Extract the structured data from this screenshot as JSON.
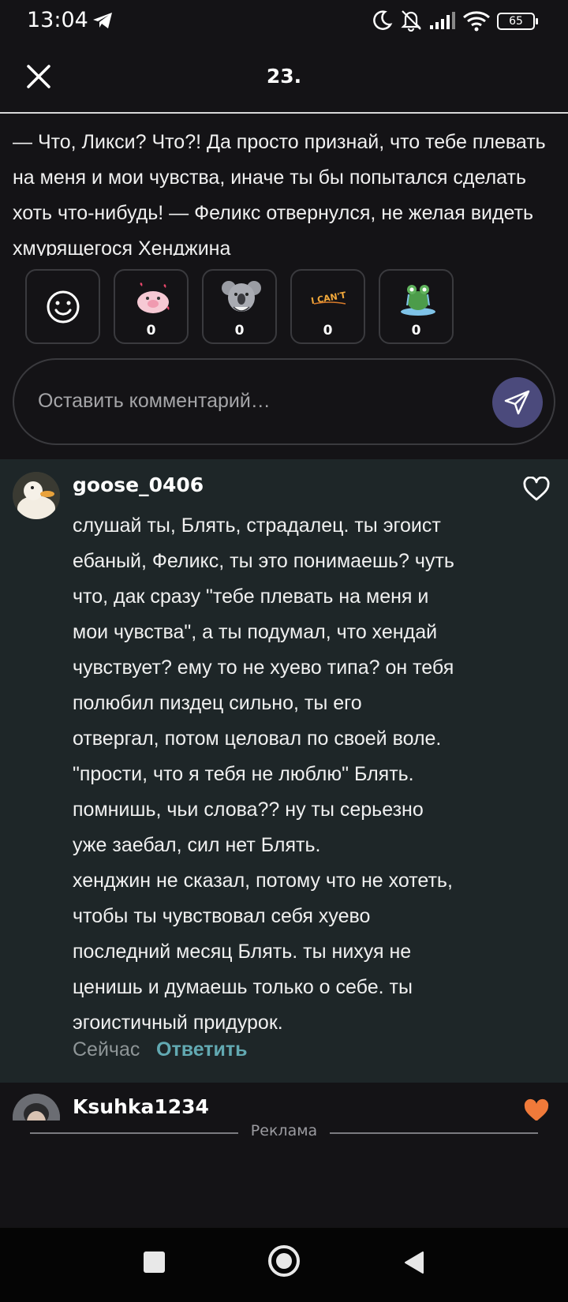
{
  "status_bar": {
    "time": "13:04",
    "battery": "65"
  },
  "header": {
    "title": "23."
  },
  "story": {
    "text": "— Что, Ликси? Что?! Да просто признай, что тебе плевать на меня и мои чувства, иначе ты бы попытался сделать хоть что-нибудь! — Феликс отвернулся, не желая видеть хмурящегося Хенджина"
  },
  "reactions": [
    {
      "icon": "smiley-add-icon"
    },
    {
      "icon": "pig-love-sticker",
      "count": "0"
    },
    {
      "icon": "koala-laugh-sticker",
      "count": "0"
    },
    {
      "icon": "i-cant-sticker",
      "count": "0"
    },
    {
      "icon": "frog-cry-sticker",
      "count": "0"
    }
  ],
  "comment_input": {
    "placeholder": "Оставить комментарий…"
  },
  "comments": [
    {
      "username": "goose_0406",
      "lines": [
        "слушай ты, Блять, страдалец. ты эгоист",
        "ебаный, Феликс, ты это понимаешь? чуть",
        "что, дак сразу \"тебе плевать на меня и",
        "мои чувства\", а ты подумал, что хендай",
        "чувствует? ему то не хуево типа? он тебя",
        "полюбил пиздец сильно, ты его",
        "отвергал, потом целовал по своей воле.",
        "\"прости, что я тебя не люблю\" Блять.",
        "помнишь, чьи слова?? ну ты серьезно",
        "уже заебал, сил нет Блять.",
        "хенджин не сказал, потому что не хотеть,",
        "чтобы ты чувствовал себя хуево",
        "последний месяц Блять. ты нихуя не",
        "ценишь и думаешь только о себе. ты",
        "эгоистичный придурок."
      ],
      "time": "Сейчас",
      "reply_label": "Ответить"
    },
    {
      "username": "Ksuhka1234"
    }
  ],
  "ad": {
    "label": "Реклама"
  },
  "colors": {
    "accent": "#62a9b2",
    "send_button": "#4b4a7c",
    "like_active": "#f07a3a"
  }
}
